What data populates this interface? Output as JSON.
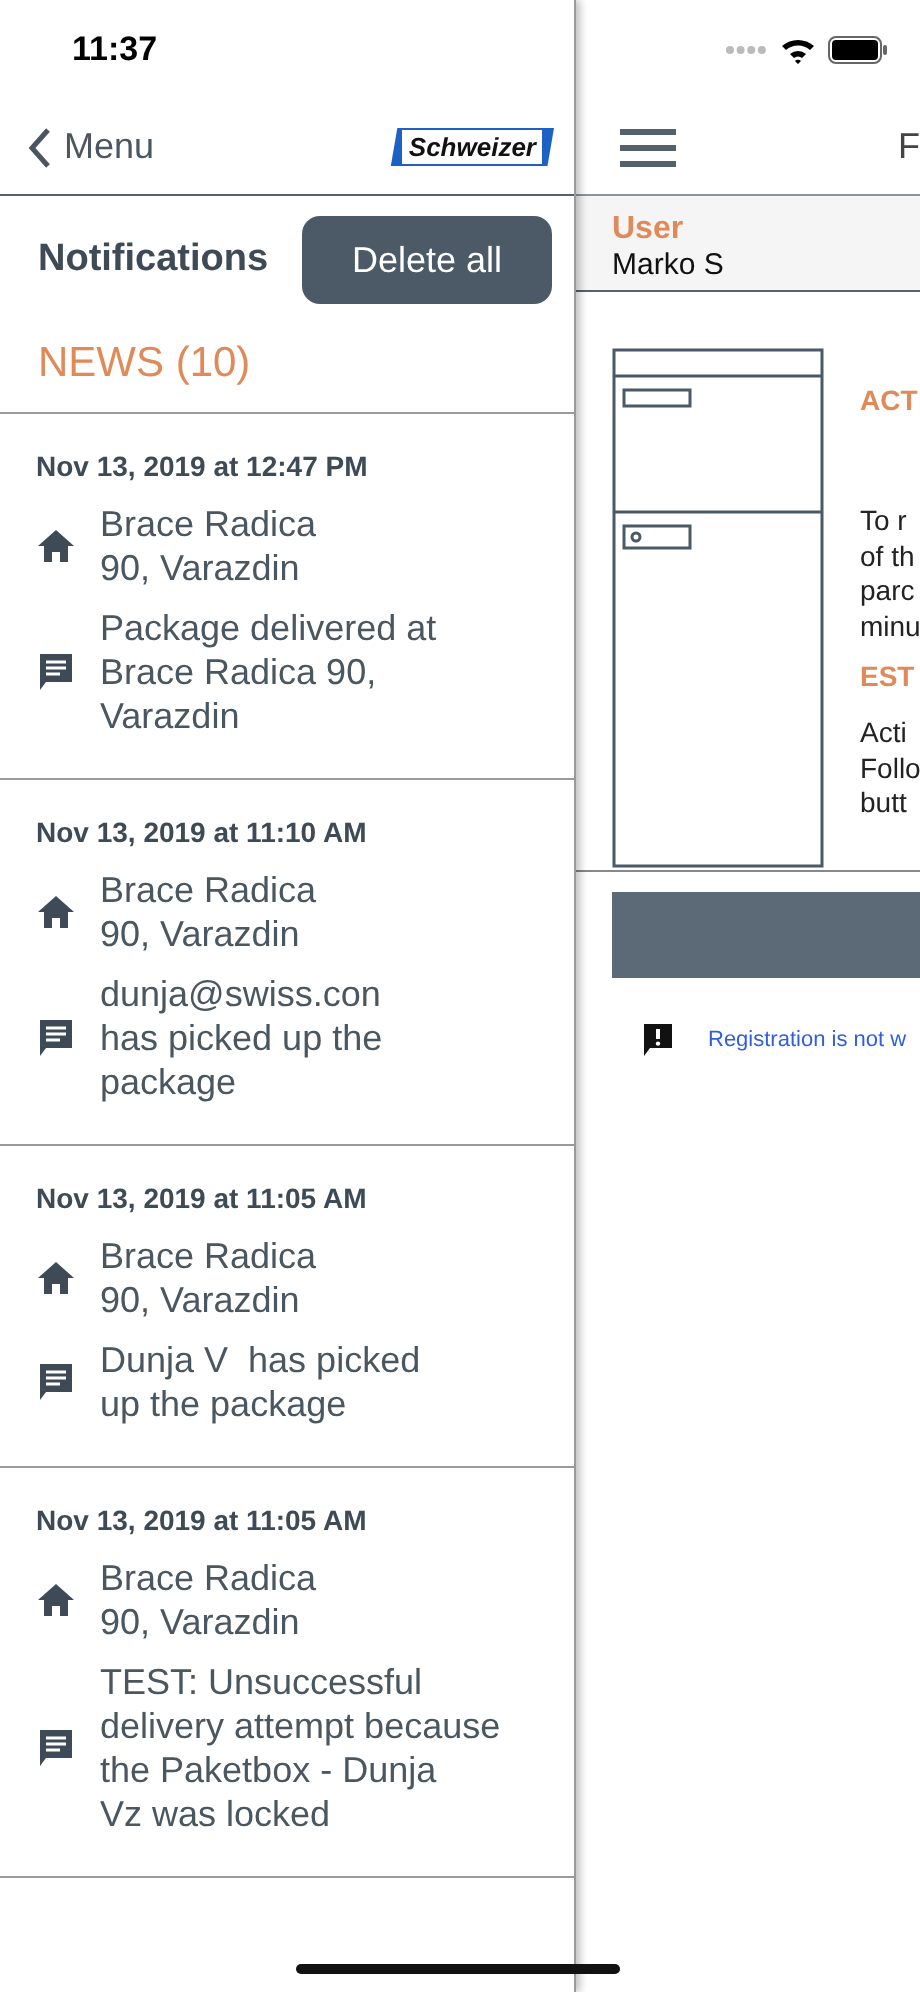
{
  "status_bar": {
    "time": "11:37"
  },
  "drawer": {
    "back_label": "Menu",
    "logo_text": "Schweizer",
    "title": "Notifications",
    "delete_button": "Delete all",
    "section": "NEWS (10)",
    "notifications": [
      {
        "date": "Nov 13, 2019 at 12:47 PM",
        "address": "Brace Radica\n90, Varazdin",
        "message": "Package delivered at\nBrace Radica 90,\nVarazdin"
      },
      {
        "date": "Nov 13, 2019 at 11:10 AM",
        "address": "Brace Radica\n90, Varazdin",
        "message": "dunja@swiss.con\nhas picked up the\npackage"
      },
      {
        "date": "Nov 13, 2019 at 11:05 AM",
        "address": "Brace Radica\n90, Varazdin",
        "message": "Dunja V  has picked\nup the package"
      },
      {
        "date": "Nov 13, 2019 at 11:05 AM",
        "address": "Brace Radica\n90, Varazdin",
        "message": "TEST: Unsuccessful\ndelivery attempt because\nthe Paketbox - Dunja\nVz was locked"
      }
    ]
  },
  "main": {
    "title": "F",
    "user_label": "User",
    "user_name": "Marko S",
    "heading_1": "ACT",
    "paragraph_1": [
      "To r",
      "of th",
      "parc",
      "minu"
    ],
    "heading_2": "EST",
    "paragraph_2": [
      "Acti",
      "Follo",
      "butt"
    ],
    "warning": "Registration is not w"
  }
}
